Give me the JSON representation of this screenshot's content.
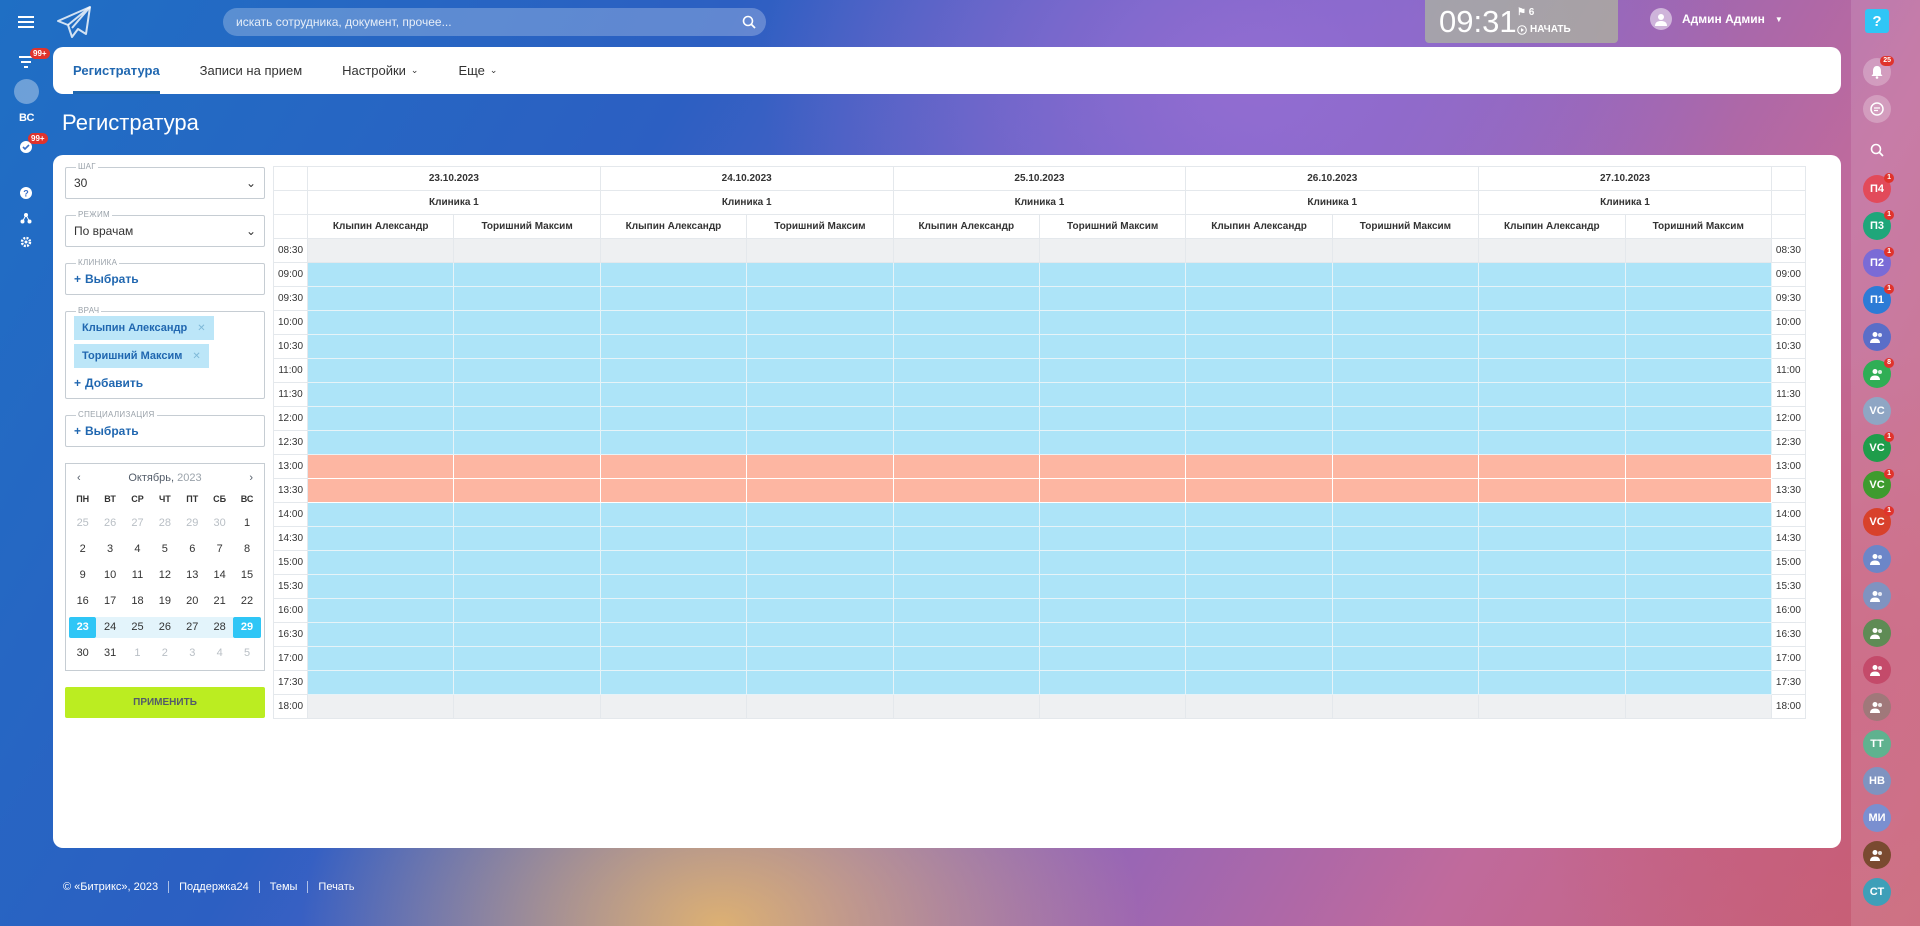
{
  "left_rail": {
    "badge_filter": "99+",
    "badge_tasks": "99+",
    "group_label": "ВС"
  },
  "search": {
    "placeholder": "искать сотрудника, документ, прочее..."
  },
  "clock": {
    "time": "09:31",
    "flag_count": "6",
    "start_label": "НАЧАТЬ"
  },
  "user": {
    "name": "Админ Админ"
  },
  "tabs": [
    {
      "label": "Регистратура",
      "active": true,
      "dropdown": false
    },
    {
      "label": "Записи на прием",
      "active": false,
      "dropdown": false
    },
    {
      "label": "Настройки",
      "active": false,
      "dropdown": true
    },
    {
      "label": "Еще",
      "active": false,
      "dropdown": true
    }
  ],
  "page_title": "Регистратура",
  "filters": {
    "step": {
      "label": "ШАГ",
      "value": "30"
    },
    "mode": {
      "label": "РЕЖИМ",
      "value": "По врачам"
    },
    "clinic": {
      "label": "КЛИНИКА",
      "action": "Выбрать"
    },
    "doctor": {
      "label": "ВРАЧ",
      "chips": [
        "Клыпин Александр",
        "Торишний Максим"
      ],
      "action": "Добавить"
    },
    "specialization": {
      "label": "СПЕЦИАЛИЗАЦИЯ",
      "action": "Выбрать"
    },
    "apply_label": "ПРИМЕНИТЬ"
  },
  "calendar": {
    "month": "Октябрь,",
    "year": "2023",
    "weekdays": [
      "ПН",
      "ВТ",
      "СР",
      "ЧТ",
      "ПТ",
      "СБ",
      "ВС"
    ],
    "weeks": [
      [
        "25",
        "26",
        "27",
        "28",
        "29",
        "30",
        "1"
      ],
      [
        "2",
        "3",
        "4",
        "5",
        "6",
        "7",
        "8"
      ],
      [
        "9",
        "10",
        "11",
        "12",
        "13",
        "14",
        "15"
      ],
      [
        "16",
        "17",
        "18",
        "19",
        "20",
        "21",
        "22"
      ],
      [
        "23",
        "24",
        "25",
        "26",
        "27",
        "28",
        "29"
      ],
      [
        "30",
        "31",
        "1",
        "2",
        "3",
        "4",
        "5"
      ]
    ],
    "selected_start": "23",
    "selected_end": "29"
  },
  "schedule": {
    "dates": [
      "23.10.2023",
      "24.10.2023",
      "25.10.2023",
      "26.10.2023",
      "27.10.2023"
    ],
    "clinic": "Клиника 1",
    "doctors": [
      "Клыпин Александр",
      "Торишний Максим"
    ],
    "times": [
      "08:30",
      "09:00",
      "09:30",
      "10:00",
      "10:30",
      "11:00",
      "11:30",
      "12:00",
      "12:30",
      "13:00",
      "13:30",
      "14:00",
      "14:30",
      "15:00",
      "15:30",
      "16:00",
      "16:30",
      "17:00",
      "17:30",
      "18:00"
    ],
    "row_states": [
      "off",
      "free",
      "free",
      "free",
      "free",
      "free",
      "free",
      "free",
      "free",
      "break",
      "break",
      "free",
      "free",
      "free",
      "free",
      "free",
      "free",
      "free",
      "free",
      "off"
    ],
    "colors": {
      "free": "#ade4f8",
      "break": "#fdb6a2",
      "off": "#eef0f2"
    }
  },
  "right_rail": {
    "notification_count": "25",
    "items": [
      {
        "text": "П4",
        "color": "#e24a5a",
        "badge": "1"
      },
      {
        "text": "П3",
        "color": "#1fa67a",
        "badge": "1"
      },
      {
        "text": "П2",
        "color": "#7a6bd6",
        "badge": "1"
      },
      {
        "text": "П1",
        "color": "#2c7bd6",
        "badge": "1"
      },
      {
        "text": "",
        "color": "#5a6ec8",
        "badge": ""
      },
      {
        "text": "",
        "color": "#2fae55",
        "badge": "8"
      },
      {
        "text": "VC",
        "color": "#8fa6c4",
        "badge": ""
      },
      {
        "text": "VC",
        "color": "#1f9d4b",
        "badge": "1"
      },
      {
        "text": "VC",
        "color": "#3e9b2e",
        "badge": "1"
      },
      {
        "text": "VC",
        "color": "#d8412b",
        "badge": "1"
      },
      {
        "text": "",
        "color": "#6c86c8",
        "badge": ""
      },
      {
        "text": "",
        "color": "#7f93c0",
        "badge": ""
      },
      {
        "text": "",
        "color": "#5f8b55",
        "badge": ""
      },
      {
        "text": "",
        "color": "#c44a6a",
        "badge": ""
      },
      {
        "text": "",
        "color": "#a0787a",
        "badge": ""
      },
      {
        "text": "ТТ",
        "color": "#5fb28f",
        "badge": ""
      },
      {
        "text": "НВ",
        "color": "#7f93c0",
        "badge": ""
      },
      {
        "text": "МИ",
        "color": "#7a8fd0",
        "badge": ""
      },
      {
        "text": "",
        "color": "#7a4a30",
        "badge": ""
      },
      {
        "text": "СТ",
        "color": "#3e9fb8",
        "badge": ""
      }
    ]
  },
  "footer": [
    "© «Битрикс», 2023",
    "Поддержка24",
    "Темы",
    "Печать"
  ]
}
